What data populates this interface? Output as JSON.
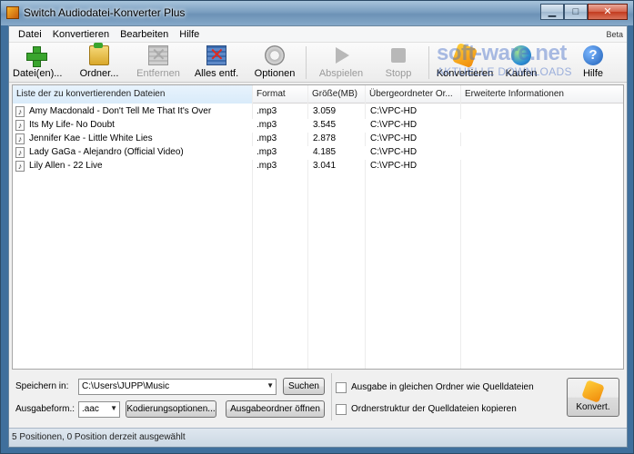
{
  "window": {
    "title": "Switch Audiodatei-Konverter Plus",
    "controls": {
      "minimize": "▁",
      "maximize": "□",
      "close": "✕"
    }
  },
  "menu": {
    "items": [
      "Datei",
      "Konvertieren",
      "Bearbeiten",
      "Hilfe"
    ],
    "badge": "Beta"
  },
  "toolbar": {
    "add_files": "Datei(en)...",
    "add_folder": "Ordner...",
    "remove": "Entfernen",
    "remove_all": "Alles entf.",
    "options": "Optionen",
    "play": "Abspielen",
    "stop": "Stopp",
    "convert": "Konvertieren",
    "buy": "Kaufen",
    "help": "Hilfe",
    "help_glyph": "?"
  },
  "watermark": {
    "brand": "soft-ware.net",
    "tagline": "AKTUELLE DOWNLOADS"
  },
  "file_list": {
    "columns": [
      "Liste der zu konvertierenden Dateien",
      "Format",
      "Größe(MB)",
      "Übergeordneter Or...",
      "Erweiterte Informationen"
    ],
    "rows": [
      {
        "name": "Amy Macdonald - Don't Tell Me That It's Over",
        "format": ".mp3",
        "size": "3.059",
        "folder": "C:\\VPC-HD",
        "info": ""
      },
      {
        "name": "Its My Life- No Doubt",
        "format": ".mp3",
        "size": "3.545",
        "folder": "C:\\VPC-HD",
        "info": ""
      },
      {
        "name": "Jennifer Kae - Little White Lies",
        "format": ".mp3",
        "size": "2.878",
        "folder": "C:\\VPC-HD",
        "info": ""
      },
      {
        "name": "Lady GaGa - Alejandro (Official Video)",
        "format": ".mp3",
        "size": "4.185",
        "folder": "C:\\VPC-HD",
        "info": ""
      },
      {
        "name": "Lily Allen - 22 Live",
        "format": ".mp3",
        "size": "3.041",
        "folder": "C:\\VPC-HD",
        "info": ""
      }
    ]
  },
  "output": {
    "save_in_label": "Speichern in:",
    "save_in_value": "C:\\Users\\JUPP\\Music",
    "search_button": "Suchen",
    "format_label": "Ausgabeform.:",
    "format_value": ".aac",
    "encoding_button": "Kodierungsoptionen...",
    "open_folder_button": "Ausgabeordner öffnen",
    "same_folder_label": "Ausgabe in gleichen Ordner wie Quelldateien",
    "copy_structure_label": "Ordnerstruktur der Quelldateien kopieren",
    "convert_button": "Konvert."
  },
  "status": {
    "text": "5 Positionen, 0 Position derzeit ausgewählt"
  }
}
